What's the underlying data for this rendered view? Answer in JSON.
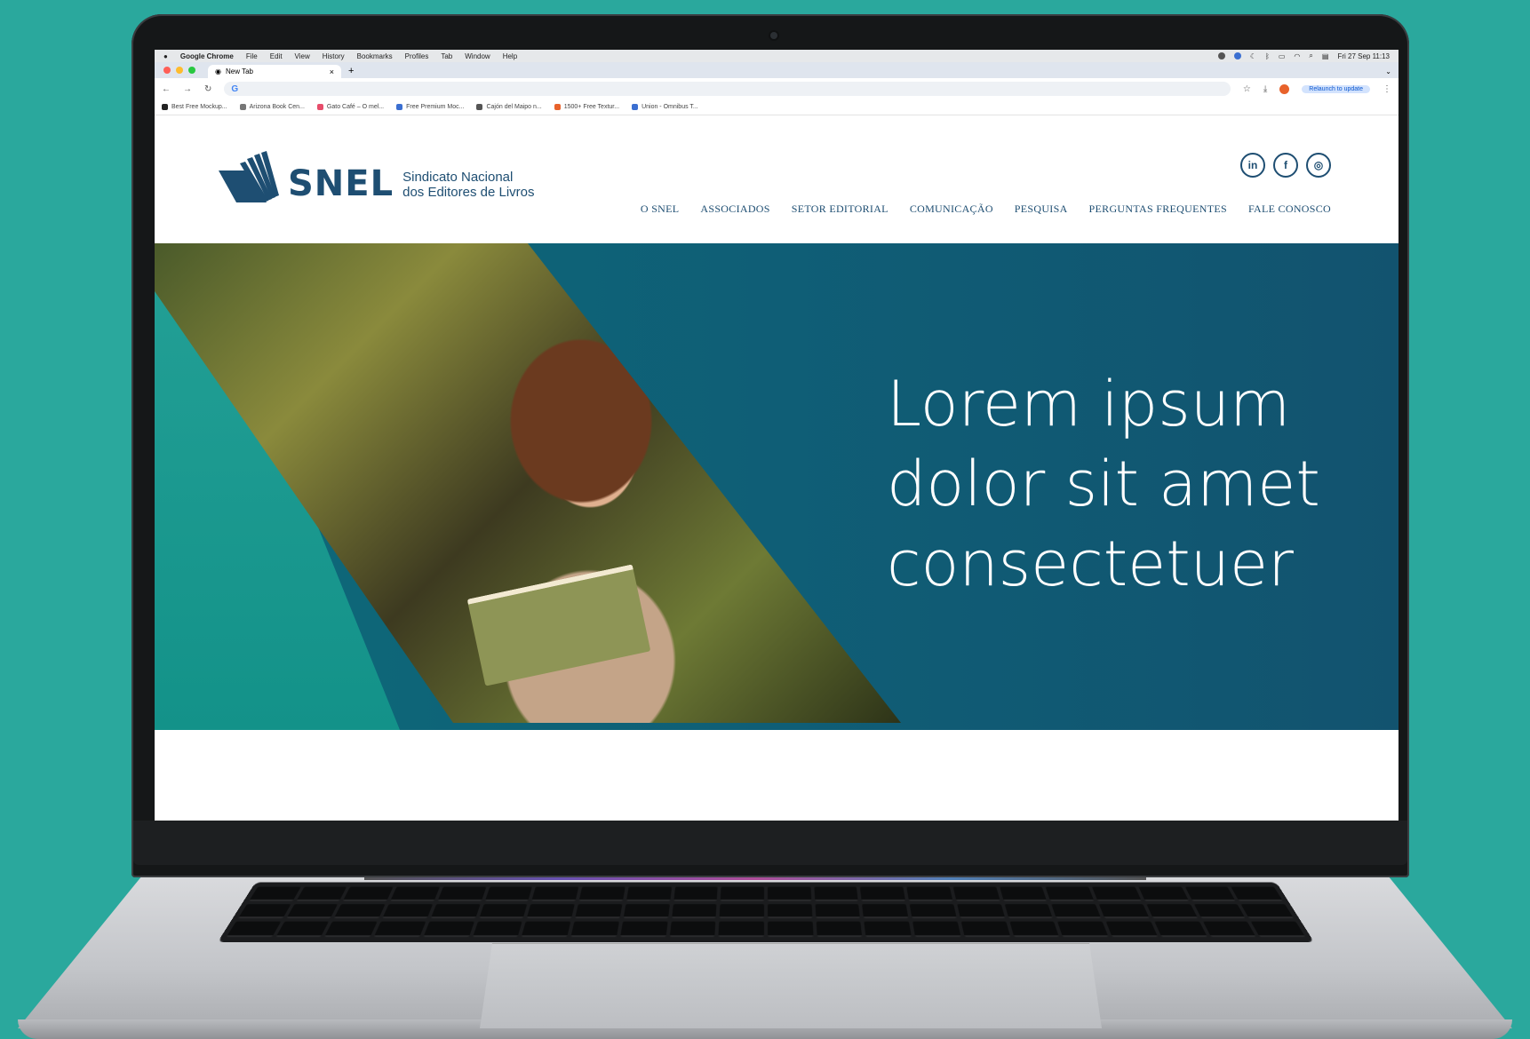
{
  "menubar": {
    "app": "Google Chrome",
    "items": [
      "File",
      "Edit",
      "View",
      "History",
      "Bookmarks",
      "Profiles",
      "Tab",
      "Window",
      "Help"
    ],
    "clock": "Fri 27 Sep 11:13"
  },
  "browser": {
    "tab_title": "New Tab",
    "new_tab": "+",
    "relaunch": "Relaunch to update",
    "bookmarks": [
      "Best Free Mockup...",
      "Arizona Book Cen...",
      "Gato Café – O mel...",
      "Free Premium Moc...",
      "Cajón del Maipo n...",
      "1500+ Free Textur...",
      "Union - Omnibus T..."
    ]
  },
  "site": {
    "logo": "SNEL",
    "logo_sub_1": "Sindicato Nacional",
    "logo_sub_2": "dos Editores de Livros",
    "social": [
      "in",
      "f",
      "◎"
    ],
    "nav": [
      "O SNEL",
      "ASSOCIADOS",
      "SETOR EDITORIAL",
      "COMUNICAÇÃO",
      "PESQUISA",
      "PERGUNTAS FREQUENTES",
      "FALE CONOSCO"
    ],
    "hero_title_1": "Lorem ipsum",
    "hero_title_2": "dolor sit amet",
    "hero_title_3": "consectetuer"
  },
  "colors": {
    "background": "#2aa89d",
    "brand": "#1e4e72",
    "hero": "#0f5e76"
  }
}
